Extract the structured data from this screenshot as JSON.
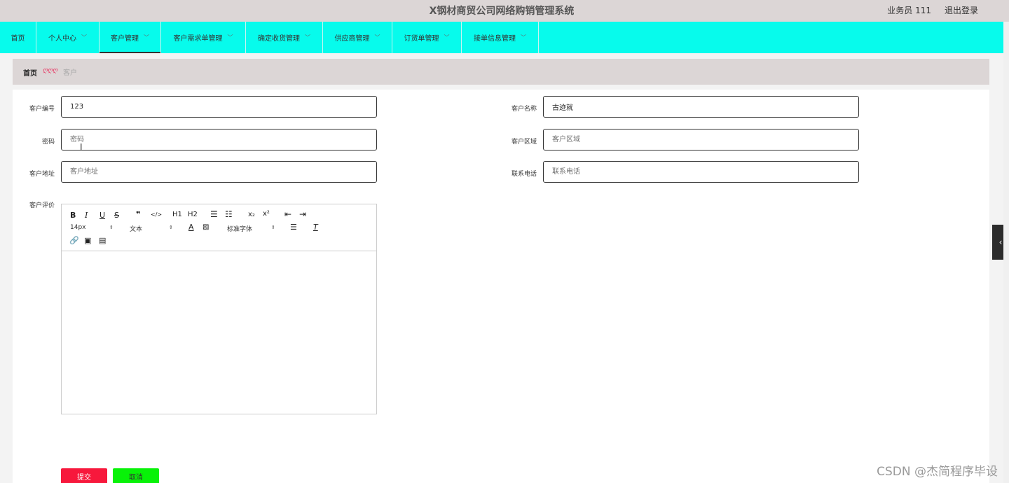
{
  "header": {
    "title": "X钢材商贸公司网络购销管理系统",
    "user": "业务员 111",
    "logout": "退出登录"
  },
  "nav": [
    {
      "label": "首页",
      "has_dropdown": false
    },
    {
      "label": "个人中心",
      "has_dropdown": true
    },
    {
      "label": "客户管理",
      "has_dropdown": true,
      "active": true
    },
    {
      "label": "客户需求单管理",
      "has_dropdown": true
    },
    {
      "label": "确定收货管理",
      "has_dropdown": true
    },
    {
      "label": "供应商管理",
      "has_dropdown": true
    },
    {
      "label": "订货单管理",
      "has_dropdown": true
    },
    {
      "label": "接单信息管理",
      "has_dropdown": true
    }
  ],
  "breadcrumb": {
    "home": "首页",
    "separator": "ღღღ",
    "current": "客户"
  },
  "form": {
    "customer_no": {
      "label": "客户编号",
      "value": "123",
      "placeholder": "客户编号"
    },
    "customer_name": {
      "label": "客户名称",
      "value": "古迹就",
      "placeholder": "客户名称"
    },
    "password": {
      "label": "密码",
      "value": "",
      "placeholder": "密码"
    },
    "customer_region": {
      "label": "客户区域",
      "value": "",
      "placeholder": "客户区域"
    },
    "customer_address": {
      "label": "客户地址",
      "value": "",
      "placeholder": "客户地址"
    },
    "contact_phone": {
      "label": "联系电话",
      "value": "",
      "placeholder": "联系电话"
    },
    "customer_review": {
      "label": "客户评价"
    }
  },
  "editor": {
    "font_size": "14px",
    "text_style": "文本",
    "font_family": "标准字体",
    "buttons": [
      "B",
      "I",
      "U",
      "S",
      "❞",
      "</>",
      "H1",
      "H2",
      "ordered-list",
      "bullet-list",
      "x₂",
      "x²",
      "outdent",
      "indent",
      "A",
      "background-color",
      "align",
      "clear-format",
      "link",
      "image",
      "video"
    ]
  },
  "actions": {
    "submit": "提交",
    "cancel": "取消"
  },
  "watermark": "CSDN @杰简程序毕设",
  "colors": {
    "header_bg": "#dcd6d6",
    "nav_bg": "#07fbec",
    "submit_bg": "#f7183c",
    "cancel_bg": "#08f208"
  }
}
